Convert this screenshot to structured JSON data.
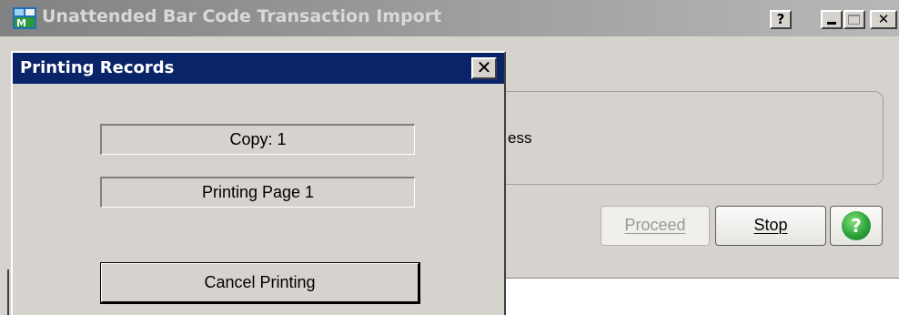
{
  "window": {
    "title": "Unattended Bar Code Transaction Import",
    "help_label": "?",
    "close_label": "✕"
  },
  "main": {
    "group_text": "ess",
    "proceed_label": "Proceed",
    "stop_label": "Stop",
    "help_glyph": "?"
  },
  "dialog": {
    "title": "Printing Records",
    "close_label": "✕",
    "copy_text": "Copy:  1",
    "page_text": "Printing Page 1",
    "cancel_label": "Cancel Printing"
  },
  "icons": {
    "app_icon": "app-icon",
    "help_button_icon": "green-help-circle-icon"
  },
  "colors": {
    "dialog_titlebar": "#0a246a",
    "window_face": "#d6d3ce",
    "main_titlebar_inactive": "#9a9a9a",
    "help_green": "#2ea33a"
  }
}
